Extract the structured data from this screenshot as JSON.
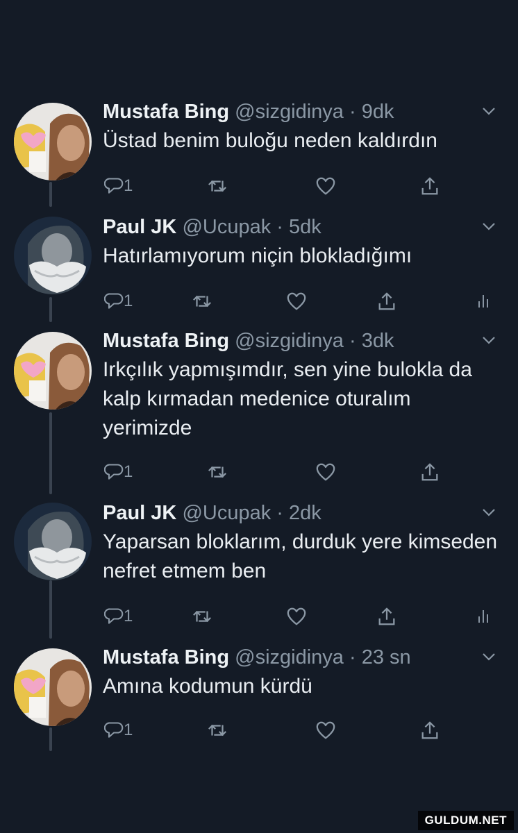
{
  "tweets": [
    {
      "name": "Mustafa Bing",
      "handle": "@sizgidinya",
      "dot": "·",
      "time": "9dk",
      "text": "Üstad benim buloğu neden kaldırdın",
      "reply_count": "1"
    },
    {
      "name": "Paul JK",
      "handle": "@Ucupak",
      "dot": "·",
      "time": "5dk",
      "text": "Hatırlamıyorum niçin blokladığımı",
      "reply_count": "1"
    },
    {
      "name": "Mustafa Bing",
      "handle": "@sizgidinya",
      "dot": "·",
      "time": "3dk",
      "text": "Irkçılık yapmışımdır, sen yine bulokla da kalp kırmadan medenice oturalım yerimizde",
      "reply_count": "1"
    },
    {
      "name": "Paul JK",
      "handle": "@Ucupak",
      "dot": "·",
      "time": "2dk",
      "text": "Yaparsan bloklarım, durduk yere kimseden nefret etmem ben",
      "reply_count": "1"
    },
    {
      "name": "Mustafa Bing",
      "handle": "@sizgidinya",
      "dot": "·",
      "time": "23 sn",
      "text": "Amına kodumun kürdü",
      "reply_count": "1"
    }
  ],
  "icons": {
    "reply": "reply-icon",
    "retweet": "retweet-icon",
    "like": "heart-icon",
    "share": "share-icon",
    "analytics": "analytics-icon",
    "more": "chevron-down-icon"
  },
  "watermark": "GULDUM.NET",
  "colors": {
    "background": "#141b26",
    "secondary_text": "#8b98a5",
    "thread_line": "#3a4350"
  }
}
